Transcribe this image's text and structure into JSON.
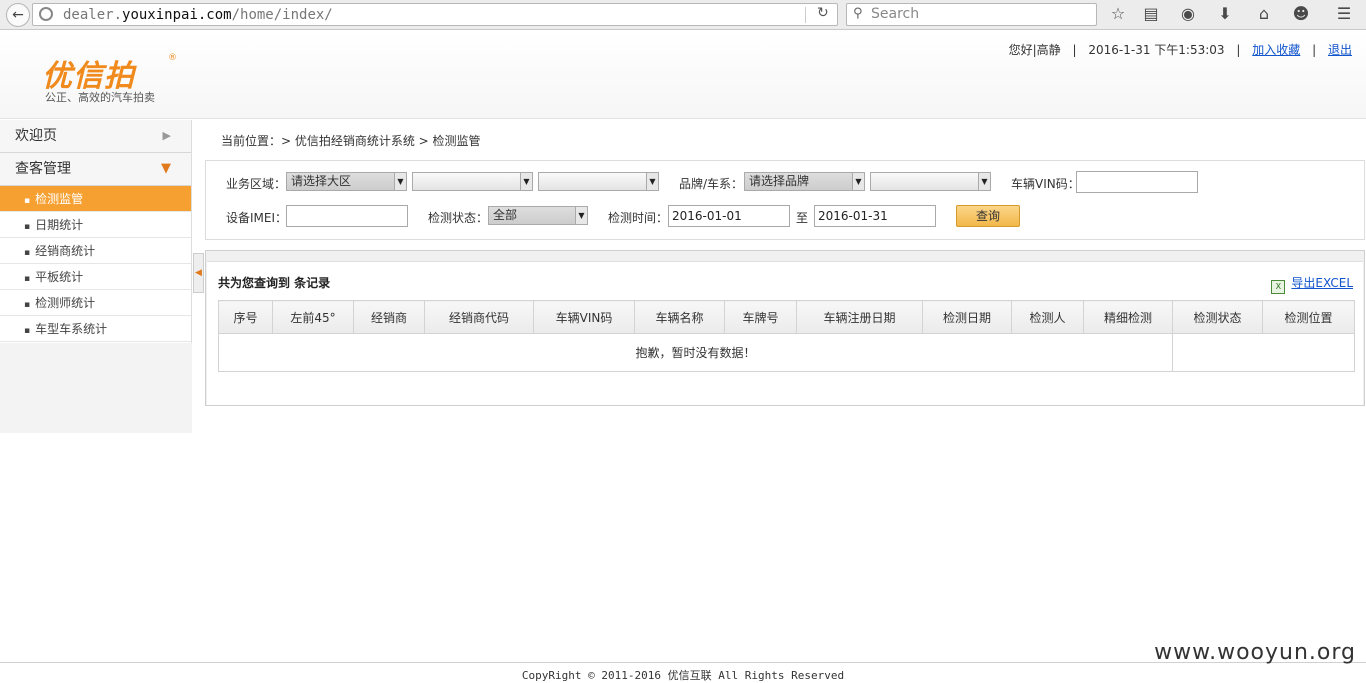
{
  "browser": {
    "url_prefix": "dealer.",
    "url_domain": "youxinpai.com",
    "url_path": "/home/index/",
    "search_placeholder": "Search"
  },
  "header": {
    "logo": "优信拍",
    "logo_reg": "®",
    "slogan": "公正、高效的汽车拍卖",
    "greeting": "您好",
    "user_name": "高静",
    "datetime": "2016-1-31  下午1:53:03",
    "add_favorite": "加入收藏",
    "logout": "退出",
    "divider": "|"
  },
  "sidebar": {
    "welcome": "欢迎页",
    "section": "查客管理",
    "items": [
      {
        "label": "检测监管",
        "active": true
      },
      {
        "label": "日期统计",
        "active": false
      },
      {
        "label": "经销商统计",
        "active": false
      },
      {
        "label": "平板统计",
        "active": false
      },
      {
        "label": "检测师统计",
        "active": false
      },
      {
        "label": "车型车系统计",
        "active": false
      }
    ]
  },
  "breadcrumb": "当前位置：> 优信拍经销商统计系统 > 检测监管",
  "filters": {
    "region_label": "业务区域：",
    "region_value": "请选择大区",
    "brand_label": "品牌/车系：",
    "brand_value": "请选择品牌",
    "vin_label": "车辆VIN码：",
    "imei_label": "设备IMEI：",
    "status_label": "检测状态：",
    "status_value": "全部",
    "time_label": "检测时间：",
    "date_from": "2016-01-01",
    "date_to_label": "至",
    "date_to": "2016-01-31",
    "query_button": "查询"
  },
  "results": {
    "summary": "共为您查询到  条记录",
    "export": "导出EXCEL",
    "columns": [
      "序号",
      "左前45°",
      "经销商",
      "经销商代码",
      "车辆VIN码",
      "车辆名称",
      "车牌号",
      "车辆注册日期",
      "检测日期",
      "检测人",
      "精细检测",
      "检测状态",
      "检测位置"
    ],
    "empty_message": "抱歉，暂时没有数据！"
  },
  "footer": "CopyRight © 2011-2016 优信互联 All Rights Reserved",
  "watermark": "www.wooyun.org"
}
